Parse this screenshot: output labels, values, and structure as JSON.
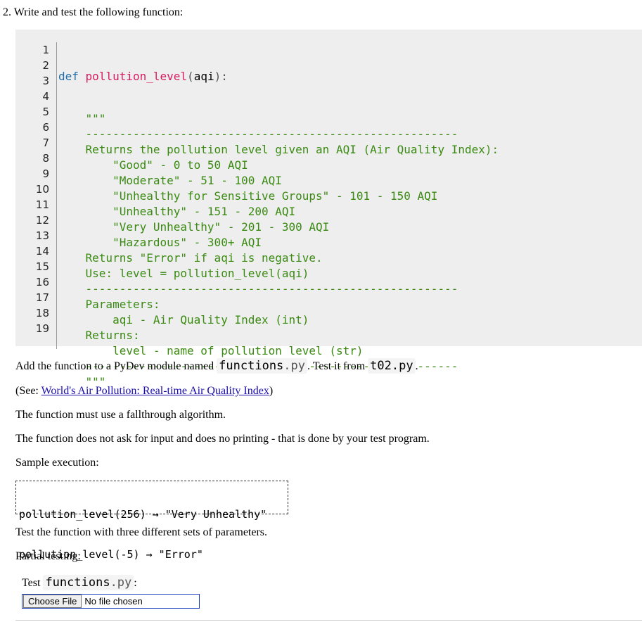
{
  "question": {
    "number": "2.",
    "text": "Write and test the following function:"
  },
  "code": {
    "line_numbers": [
      "1",
      "2",
      "3",
      "4",
      "5",
      "6",
      "7",
      "8",
      "9",
      "10",
      "11",
      "12",
      "13",
      "14",
      "15",
      "16",
      "17",
      "18",
      "19"
    ],
    "def_keyword": "def",
    "func_name": "pollution_level",
    "open_paren": "(",
    "param": "aqi",
    "close_paren": "):",
    "lines": [
      "    \"\"\"",
      "    -------------------------------------------------------",
      "    Returns the pollution level given an AQI (Air Quality Index):",
      "        \"Good\" - 0 to 50 AQI",
      "        \"Moderate\" - 51 - 100 AQI",
      "        \"Unhealthy for Sensitive Groups\" - 101 - 150 AQI",
      "        \"Unhealthy\" - 151 - 200 AQI",
      "        \"Very Unhealthy\" - 201 - 300 AQI",
      "        \"Hazardous\" - 300+ AQI",
      "    Returns \"Error\" if aqi is negative.",
      "    Use: level = pollution_level(aqi)",
      "    -------------------------------------------------------",
      "    Parameters:",
      "        aqi - Air Quality Index (int)",
      "    Returns:",
      "        level - name of pollution level (str)",
      "    -------------------------------------------------------",
      "    \"\"\""
    ]
  },
  "instructions": {
    "add_prefix": "Add the function to a PyDev module named ",
    "module_name": "functions",
    "module_ext": ".py",
    "add_middle": ". Test it from ",
    "test_file": "t02.py",
    "add_suffix": ".",
    "see_prefix": "(See: ",
    "see_link": "World's Air Pollution: Real-time Air Quality Index",
    "see_suffix": ")",
    "fallthrough": "The function must use a fallthrough algorithm.",
    "no_input": "The function does not ask for input and does no printing - that is done by your test program.",
    "sample_label": "Sample execution:",
    "test_sets": "Test the function with three different sets of parameters.",
    "partial": "Partial testing:"
  },
  "sample": {
    "lines": [
      "pollution_level(256) → \"Very Unhealthy\"",
      "pollution_level(-5) → \"Error\""
    ]
  },
  "testing": {
    "label_prefix": "Test ",
    "module_name": "functions",
    "module_ext": ".py",
    "label_suffix": ":",
    "choose_file": "Choose File",
    "no_file": "No file chosen"
  }
}
